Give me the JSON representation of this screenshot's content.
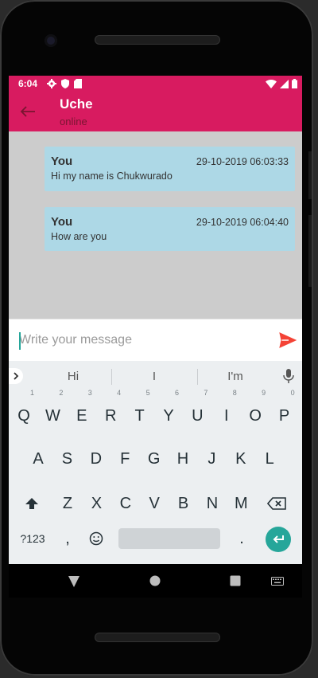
{
  "status_bar": {
    "time": "6:04",
    "left_icons": [
      "settings-gear-icon",
      "shield-icon",
      "sd-card-icon"
    ],
    "right_icons": [
      "wifi-icon",
      "signal-icon",
      "battery-icon"
    ]
  },
  "colors": {
    "primary": "#d81b60",
    "bubble": "#add8e6",
    "chat_background": "#cccccc",
    "send": "#f44336",
    "keyboard_accent": "#26a69a"
  },
  "app_bar": {
    "back_icon": "arrow-left-icon",
    "contact_name": "Uche",
    "contact_status": "online"
  },
  "messages": [
    {
      "sender": "You",
      "timestamp": "29-10-2019 06:03:33",
      "text": "Hi my name is Chukwurado"
    },
    {
      "sender": "You",
      "timestamp": "29-10-2019 06:04:40",
      "text": "How are you"
    }
  ],
  "composer": {
    "placeholder": "Write your message",
    "value": "",
    "send_icon": "send-icon"
  },
  "keyboard": {
    "suggestions": [
      "Hi",
      "I",
      "I'm"
    ],
    "row1": [
      {
        "key": "Q",
        "hint": "1"
      },
      {
        "key": "W",
        "hint": "2"
      },
      {
        "key": "E",
        "hint": "3"
      },
      {
        "key": "R",
        "hint": "4"
      },
      {
        "key": "T",
        "hint": "5"
      },
      {
        "key": "Y",
        "hint": "6"
      },
      {
        "key": "U",
        "hint": "7"
      },
      {
        "key": "I",
        "hint": "8"
      },
      {
        "key": "O",
        "hint": "9"
      },
      {
        "key": "P",
        "hint": "0"
      }
    ],
    "row2": [
      "A",
      "S",
      "D",
      "F",
      "G",
      "H",
      "J",
      "K",
      "L"
    ],
    "row3": [
      "Z",
      "X",
      "C",
      "V",
      "B",
      "N",
      "M"
    ],
    "symbols_label": "?123",
    "comma": ",",
    "period": "."
  },
  "nav_bar": [
    "back-triangle-icon",
    "home-circle-icon",
    "recents-square-icon",
    "keyboard-switch-icon"
  ]
}
